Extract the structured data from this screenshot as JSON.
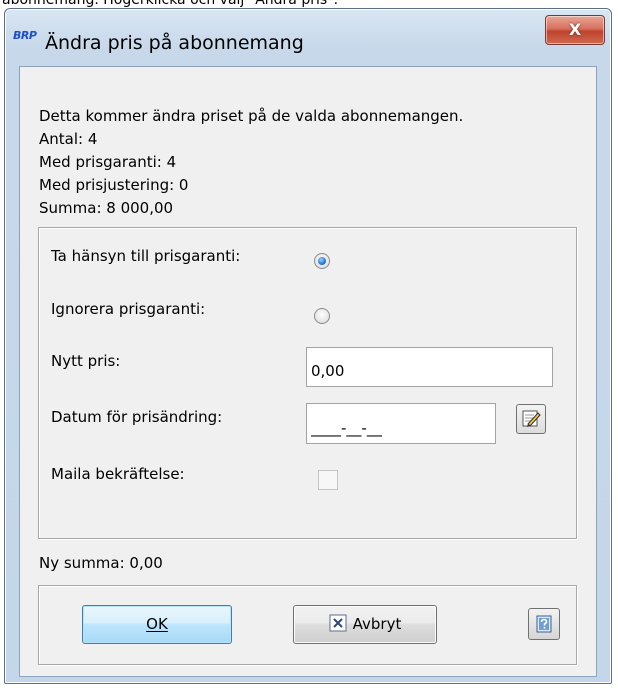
{
  "caption": "abonnemang. Högerklicka och välj \"Ändra pris\".",
  "window": {
    "logo_text": "BRP",
    "title": "Ändra pris på abonnemang",
    "close_label": "X"
  },
  "info": {
    "line1": "Detta kommer ändra priset på de valda abonnemangen.",
    "antal": "Antal: 4",
    "med_prisgaranti": "Med prisgaranti: 4",
    "med_prisjustering": "Med prisjustering: 0",
    "summa": "Summa: 8 000,00"
  },
  "options": {
    "respect_guarantee_label": "Ta hänsyn till prisgaranti:",
    "respect_guarantee_checked": true,
    "ignore_guarantee_label": "Ignorera prisgaranti:",
    "ignore_guarantee_checked": false,
    "new_price_label": "Nytt pris:",
    "new_price_value": "0,00",
    "change_date_label": "Datum för prisändring:",
    "change_date_value": "____-__-__",
    "mail_confirmation_label": "Maila bekräftelse:",
    "mail_confirmation_checked": false
  },
  "new_sum": "Ny summa: 0,00",
  "buttons": {
    "ok_label": "OK",
    "cancel_label": "Avbryt"
  },
  "icons": {
    "close": "close-icon",
    "calendar": "calendar-edit-icon",
    "cancel": "cancel-x-icon",
    "help": "help-icon"
  },
  "colors": {
    "titlebar": "#c7d8ea",
    "close_button": "#c7503a",
    "client_background": "#f0f0f0",
    "ok_button": "#bee6fd",
    "radio_selected": "#2b7ed6"
  }
}
